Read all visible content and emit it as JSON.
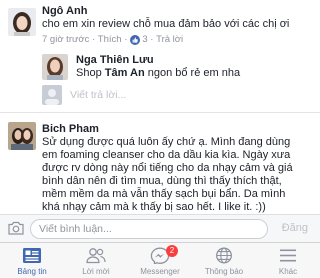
{
  "comments": [
    {
      "author": "Ngô Anh",
      "text": "cho em xin review chỗ mua đảm bảo với các chị ơi",
      "time": "7 giờ trước",
      "like_label": "Thích",
      "like_count": "3",
      "reply_label": "Trả lời",
      "replies": [
        {
          "author": "Nga Thiên Lưu",
          "text_prefix": "Shop ",
          "text_bold": "Tâm An",
          "text_suffix": " ngon bổ rẻ em nha"
        }
      ],
      "reply_placeholder": "Viết trả lời..."
    },
    {
      "author": "Bich Pham",
      "lines": [
        "Sử dụng được quá luôn ấy chứ ạ. Mình đang dùng",
        "em foaming cleanser cho da dầu kia kìa. Ngày xưa",
        "được rv dòng này nổi tiếng cho da nhạy cảm và giá",
        "bình dân nên đi tìm mua, dùng thì thấy thích thật,",
        "mềm mềm da mà vẫn thấy sạch bụi bẩn. Da mình",
        "khá nhạy cảm mà k thấy bị sao hết. I like it. :))"
      ]
    }
  ],
  "composer": {
    "placeholder": "Viết bình luận...",
    "post_label": "Đăng"
  },
  "tabbar": {
    "tabs": [
      {
        "label": "Bảng tin",
        "icon": "news-feed-icon",
        "active": true
      },
      {
        "label": "Lời mời",
        "icon": "friend-requests-icon"
      },
      {
        "label": "Messenger",
        "icon": "messenger-icon",
        "badge": "2"
      },
      {
        "label": "Thông báo",
        "icon": "notifications-icon"
      },
      {
        "label": "Khác",
        "icon": "more-icon"
      }
    ]
  },
  "colors": {
    "accent": "#4267b2",
    "badge": "#fa3e3e",
    "muted": "#90949c"
  }
}
